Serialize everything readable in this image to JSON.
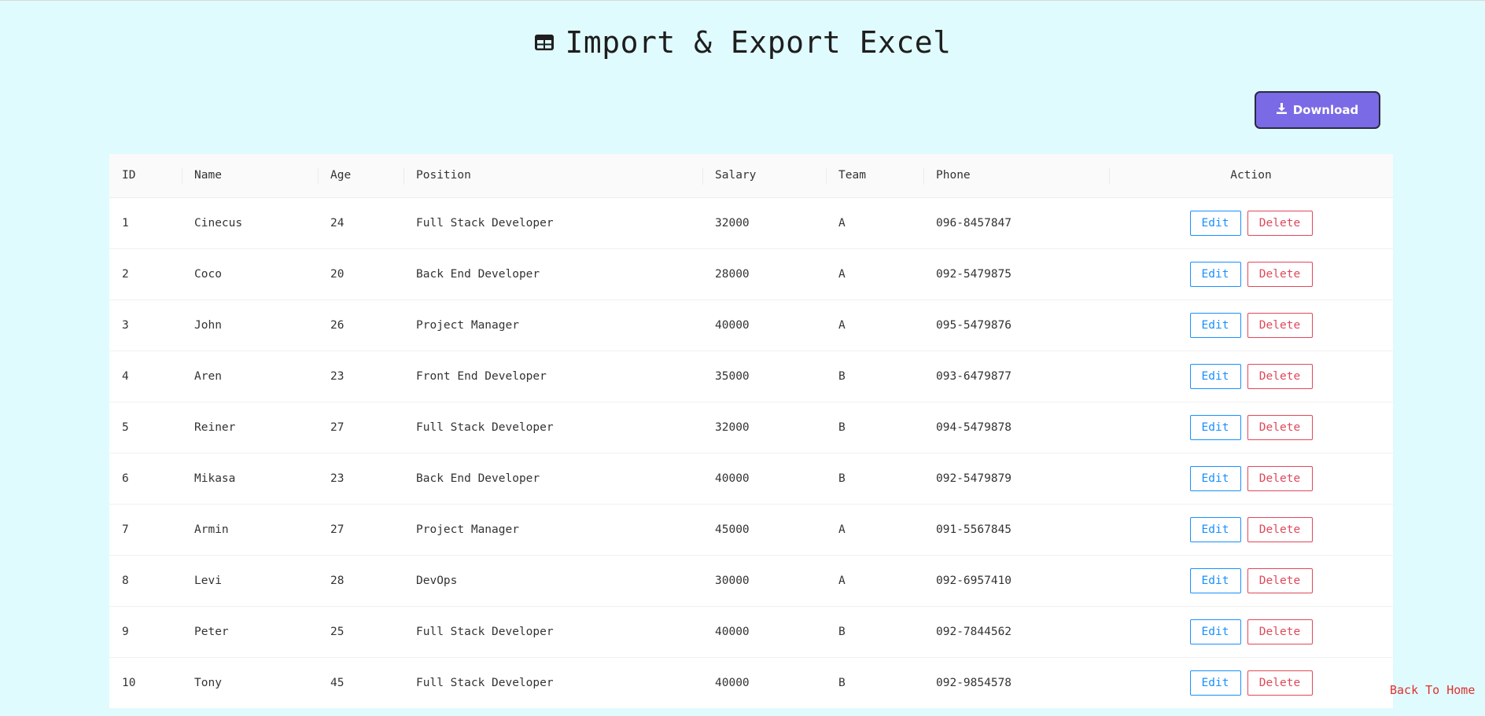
{
  "page": {
    "title": "Import & Export Excel",
    "title_icon": "table-icon",
    "download_label": "Download",
    "download_icon": "download-icon",
    "back_home_label": "Back To Home"
  },
  "table": {
    "columns": [
      "ID",
      "Name",
      "Age",
      "Position",
      "Salary",
      "Team",
      "Phone",
      "Action"
    ],
    "edit_label": "Edit",
    "delete_label": "Delete",
    "rows": [
      {
        "id": "1",
        "name": "Cinecus",
        "age": "24",
        "position": "Full Stack Developer",
        "salary": "32000",
        "team": "A",
        "phone": "096-8457847"
      },
      {
        "id": "2",
        "name": "Coco",
        "age": "20",
        "position": "Back End Developer",
        "salary": "28000",
        "team": "A",
        "phone": "092-5479875"
      },
      {
        "id": "3",
        "name": "John",
        "age": "26",
        "position": "Project Manager",
        "salary": "40000",
        "team": "A",
        "phone": "095-5479876"
      },
      {
        "id": "4",
        "name": "Aren",
        "age": "23",
        "position": "Front End Developer",
        "salary": "35000",
        "team": "B",
        "phone": "093-6479877"
      },
      {
        "id": "5",
        "name": "Reiner",
        "age": "27",
        "position": "Full Stack Developer",
        "salary": "32000",
        "team": "B",
        "phone": "094-5479878"
      },
      {
        "id": "6",
        "name": "Mikasa",
        "age": "23",
        "position": "Back End Developer",
        "salary": "40000",
        "team": "B",
        "phone": "092-5479879"
      },
      {
        "id": "7",
        "name": "Armin",
        "age": "27",
        "position": "Project Manager",
        "salary": "45000",
        "team": "A",
        "phone": "091-5567845"
      },
      {
        "id": "8",
        "name": "Levi",
        "age": "28",
        "position": "DevOps",
        "salary": "30000",
        "team": "A",
        "phone": "092-6957410"
      },
      {
        "id": "9",
        "name": "Peter",
        "age": "25",
        "position": "Full Stack Developer",
        "salary": "40000",
        "team": "B",
        "phone": "092-7844562"
      },
      {
        "id": "10",
        "name": "Tony",
        "age": "45",
        "position": "Full Stack Developer",
        "salary": "40000",
        "team": "B",
        "phone": "092-9854578"
      }
    ]
  },
  "colors": {
    "background": "#e0fbfd",
    "download_bg": "#7a6ae6",
    "edit": "#1890ff",
    "delete": "#e0485a",
    "back_home": "#e03030"
  }
}
